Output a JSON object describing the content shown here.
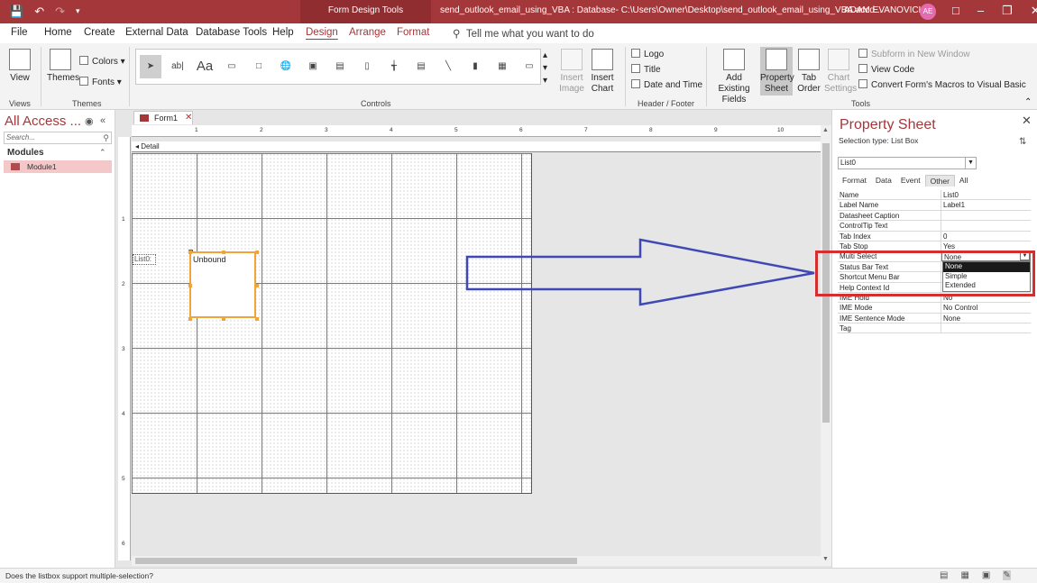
{
  "titlebar": {
    "context_label": "Form Design Tools",
    "document_title": "send_outlook_email_using_VBA : Database- C:\\Users\\Owner\\Desktop\\send_outlook_email_using_VBA.accd...",
    "user_name": "ADAM EVANOVICH",
    "user_initials": "AE",
    "accent_color": "#a4373a"
  },
  "tabs": [
    {
      "label": "File"
    },
    {
      "label": "Home"
    },
    {
      "label": "Create"
    },
    {
      "label": "External Data"
    },
    {
      "label": "Database Tools"
    },
    {
      "label": "Help"
    },
    {
      "label": "Design"
    },
    {
      "label": "Arrange"
    },
    {
      "label": "Format"
    }
  ],
  "tell_me": "Tell me what you want to do",
  "ribbon": {
    "view_label": "View",
    "themes_label": "Themes",
    "colors_label": "Colors",
    "fonts_label": "Fonts",
    "insert_image_label": "Insert Image",
    "insert_chart_label": "Insert Chart",
    "logo_label": "Logo",
    "title_label": "Title",
    "date_time_label": "Date and Time",
    "add_existing_fields_label": "Add Existing Fields",
    "property_sheet_label": "Property Sheet",
    "tab_order_label": "Tab Order",
    "chart_settings_label": "Chart Settings",
    "subform_label": "Subform in New Window",
    "view_code_label": "View Code",
    "convert_macros_label": "Convert Form's Macros to Visual Basic",
    "groups": {
      "views": "Views",
      "themes": "Themes",
      "controls": "Controls",
      "header_footer": "Header / Footer",
      "tools": "Tools"
    }
  },
  "navpane": {
    "title": "All Access ...",
    "search_placeholder": "Search...",
    "section": "Modules",
    "items": [
      {
        "label": "Module1"
      }
    ]
  },
  "document": {
    "tab_label": "Form1",
    "section_label": "Detail",
    "ruler_h": [
      "1",
      "2",
      "3",
      "4",
      "5",
      "6",
      "7",
      "8",
      "9",
      "10"
    ],
    "ruler_v": [
      "1",
      "2",
      "3",
      "4",
      "5",
      "6"
    ],
    "label_control_text": "List0:",
    "listbox_text": "Unbound"
  },
  "property_sheet": {
    "title": "Property Sheet",
    "selection_type": "Selection type:  List Box",
    "object_selected": "List0",
    "tabs": [
      {
        "label": "Format"
      },
      {
        "label": "Data"
      },
      {
        "label": "Event"
      },
      {
        "label": "Other"
      },
      {
        "label": "All"
      }
    ],
    "active_tab": "Other",
    "rows": [
      {
        "key": "Name",
        "value": "List0"
      },
      {
        "key": "Label Name",
        "value": "Label1"
      },
      {
        "key": "Datasheet Caption",
        "value": ""
      },
      {
        "key": "ControlTip Text",
        "value": ""
      },
      {
        "key": "Tab Index",
        "value": "0"
      },
      {
        "key": "Tab Stop",
        "value": "Yes"
      },
      {
        "key": "Multi Select",
        "value": "None"
      },
      {
        "key": "Status Bar Text",
        "value": ""
      },
      {
        "key": "Shortcut Menu Bar",
        "value": ""
      },
      {
        "key": "Help Context Id",
        "value": ""
      },
      {
        "key": "IME Hold",
        "value": "No"
      },
      {
        "key": "IME Mode",
        "value": "No Control"
      },
      {
        "key": "IME Sentence Mode",
        "value": "None"
      },
      {
        "key": "Tag",
        "value": ""
      }
    ],
    "multi_select_options": [
      {
        "label": "None"
      },
      {
        "label": "Simple"
      },
      {
        "label": "Extended"
      }
    ],
    "highlight_color": "#d32f2f",
    "arrow_color": "#3f48b5"
  },
  "statusbar": {
    "message": "Does the listbox support multiple-selection?"
  }
}
